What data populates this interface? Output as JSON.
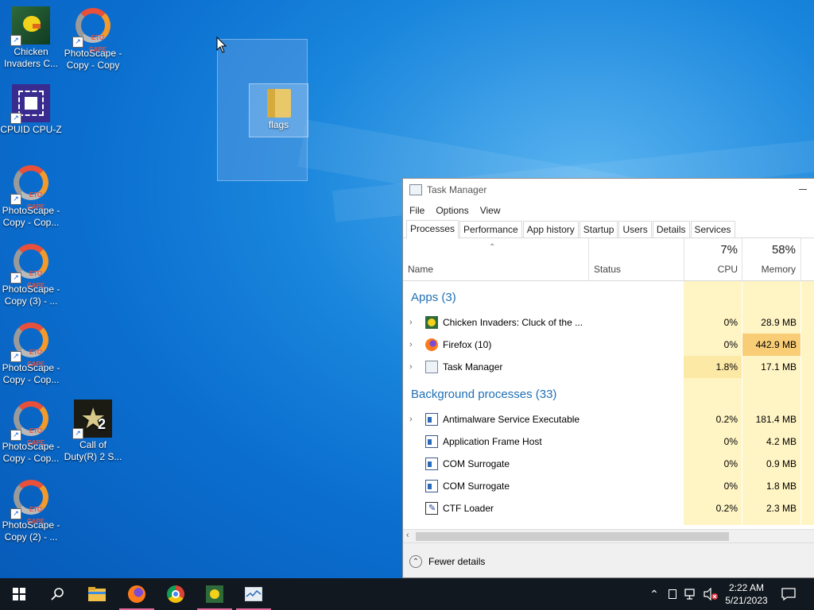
{
  "desktop": {
    "icons": [
      {
        "label": "Chicken Invaders C...",
        "icon": "chicken-invaders-icon"
      },
      {
        "label": "PhotoScape - Copy - Copy",
        "icon": "photoscape-icon"
      },
      {
        "label": "CPUID CPU-Z",
        "icon": "cpuz-icon"
      },
      {
        "label": "PhotoScape - Copy - Cop...",
        "icon": "photoscape-icon"
      },
      {
        "label": "PhotoScape - Copy (3) - ...",
        "icon": "photoscape-icon"
      },
      {
        "label": "PhotoScape - Copy - Cop...",
        "icon": "photoscape-icon"
      },
      {
        "label": "PhotoScape - Copy - Cop...",
        "icon": "photoscape-icon"
      },
      {
        "label": "Call of Duty(R) 2 S...",
        "icon": "call-of-duty-icon"
      },
      {
        "label": "PhotoScape - Copy (2) - ...",
        "icon": "photoscape-icon"
      }
    ],
    "selected_folder": {
      "label": "flags",
      "icon": "folder-icon"
    }
  },
  "task_manager": {
    "title": "Task Manager",
    "menu": [
      "File",
      "Options",
      "View"
    ],
    "tabs": [
      "Processes",
      "Performance",
      "App history",
      "Startup",
      "Users",
      "Details",
      "Services"
    ],
    "active_tab": "Processes",
    "columns": {
      "name": "Name",
      "status": "Status",
      "cpu_total": "7%",
      "cpu": "CPU",
      "mem_total": "58%",
      "memory": "Memory"
    },
    "groups": {
      "apps": "Apps (3)",
      "background": "Background processes (33)"
    },
    "apps": [
      {
        "name": "Chicken Invaders: Cluck of the ...",
        "cpu": "0%",
        "mem": "28.9 MB",
        "icon": "chicken-invaders-icon",
        "expandable": true
      },
      {
        "name": "Firefox (10)",
        "cpu": "0%",
        "mem": "442.9 MB",
        "icon": "firefox-icon",
        "expandable": true
      },
      {
        "name": "Task Manager",
        "cpu": "1.8%",
        "mem": "17.1 MB",
        "icon": "task-manager-icon",
        "expandable": true
      }
    ],
    "background": [
      {
        "name": "Antimalware Service Executable",
        "cpu": "0.2%",
        "mem": "181.4 MB",
        "icon": "service-icon",
        "expandable": true
      },
      {
        "name": "Application Frame Host",
        "cpu": "0%",
        "mem": "4.2 MB",
        "icon": "service-icon",
        "expandable": false
      },
      {
        "name": "COM Surrogate",
        "cpu": "0%",
        "mem": "0.9 MB",
        "icon": "service-icon",
        "expandable": false
      },
      {
        "name": "COM Surrogate",
        "cpu": "0%",
        "mem": "1.8 MB",
        "icon": "service-icon",
        "expandable": false
      },
      {
        "name": "CTF Loader",
        "cpu": "0.2%",
        "mem": "2.3 MB",
        "icon": "ctf-loader-icon",
        "expandable": false
      }
    ],
    "footer": "Fewer details"
  },
  "taskbar": {
    "items": [
      "start-icon",
      "search-icon",
      "file-explorer-icon",
      "firefox-icon",
      "chrome-icon",
      "chicken-invaders-icon",
      "task-manager-icon"
    ],
    "time": "2:22 AM",
    "date": "5/21/2023"
  },
  "colors": {
    "accent": "#1f6fb5",
    "usage_light": "#fff4c4",
    "usage_mid": "#fde9a6",
    "usage_high": "#f9cd76",
    "taskbar": "#11181f",
    "running_indicator": "#e56a9d"
  }
}
